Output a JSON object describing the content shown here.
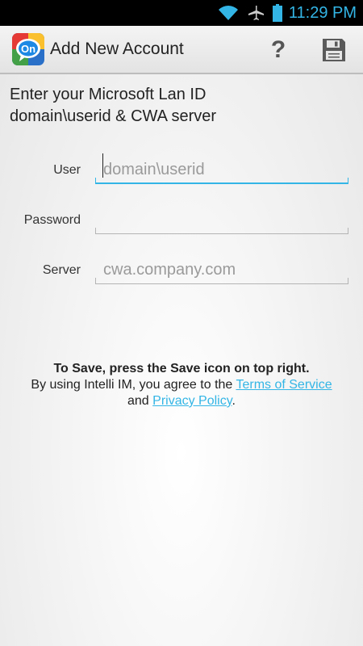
{
  "status_bar": {
    "time": "11:29 PM",
    "icons": [
      "wifi-icon",
      "airplane-icon",
      "battery-icon"
    ]
  },
  "action_bar": {
    "title": "Add New Account",
    "app_icon_text": "On",
    "help_label": "?",
    "icons": [
      "app-logo-icon",
      "help-icon",
      "save-icon"
    ]
  },
  "instructions": {
    "line1": "Enter your Microsoft Lan ID",
    "line2": "domain\\userid & CWA server"
  },
  "form": {
    "user": {
      "label": "User",
      "placeholder": "domain\\userid",
      "value": ""
    },
    "password": {
      "label": "Password",
      "placeholder": "",
      "value": ""
    },
    "server": {
      "label": "Server",
      "placeholder": "cwa.company.com",
      "value": ""
    }
  },
  "footer": {
    "save_hint": "To Save, press the Save icon on top right.",
    "agree_prefix": "By using Intelli IM, you agree to the",
    "terms_link": "Terms of Service",
    "and_text": "and",
    "privacy_link": "Privacy Policy",
    "period": "."
  },
  "colors": {
    "accent": "#33b5e5",
    "status_bar_bg": "#000000",
    "action_bar_bg": "#e9e9e9",
    "text": "#222222",
    "placeholder": "#9a9a9a"
  }
}
